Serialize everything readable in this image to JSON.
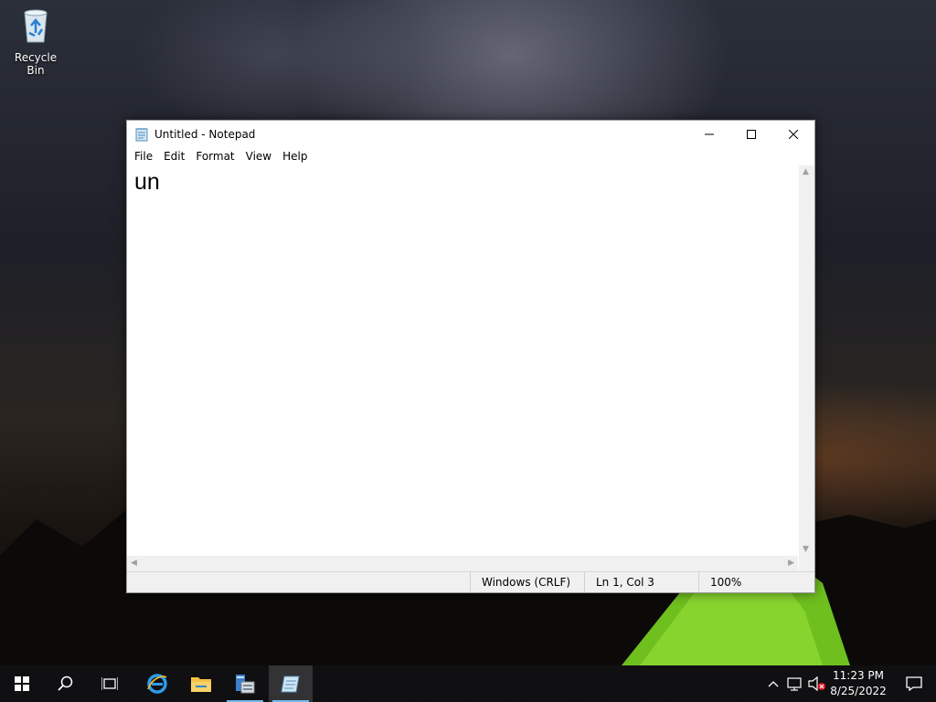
{
  "desktop": {
    "icons": [
      {
        "label": "Recycle Bin",
        "icon": "recycle-bin-icon"
      }
    ]
  },
  "window": {
    "title": "Untitled - Notepad",
    "controls": {
      "minimize": "minimize-icon",
      "maximize": "maximize-icon",
      "close": "close-icon"
    },
    "menu": [
      "File",
      "Edit",
      "Format",
      "View",
      "Help"
    ],
    "content": "un",
    "status": {
      "line_ending": "Windows (CRLF)",
      "position": "Ln 1, Col 3",
      "zoom": "100%"
    }
  },
  "taskbar": {
    "apps": [
      {
        "name": "start",
        "icon": "windows-start-icon"
      },
      {
        "name": "search",
        "icon": "search-icon"
      },
      {
        "name": "task-view",
        "icon": "task-view-icon"
      },
      {
        "name": "internet-explorer",
        "icon": "internet-explorer-icon"
      },
      {
        "name": "file-explorer",
        "icon": "folder-icon"
      },
      {
        "name": "server-manager",
        "icon": "server-manager-icon"
      },
      {
        "name": "notepad",
        "icon": "notepad-icon"
      }
    ],
    "clock": {
      "time": "11:23 PM",
      "date": "8/25/2022"
    },
    "accent_color": "#76b9ed"
  }
}
